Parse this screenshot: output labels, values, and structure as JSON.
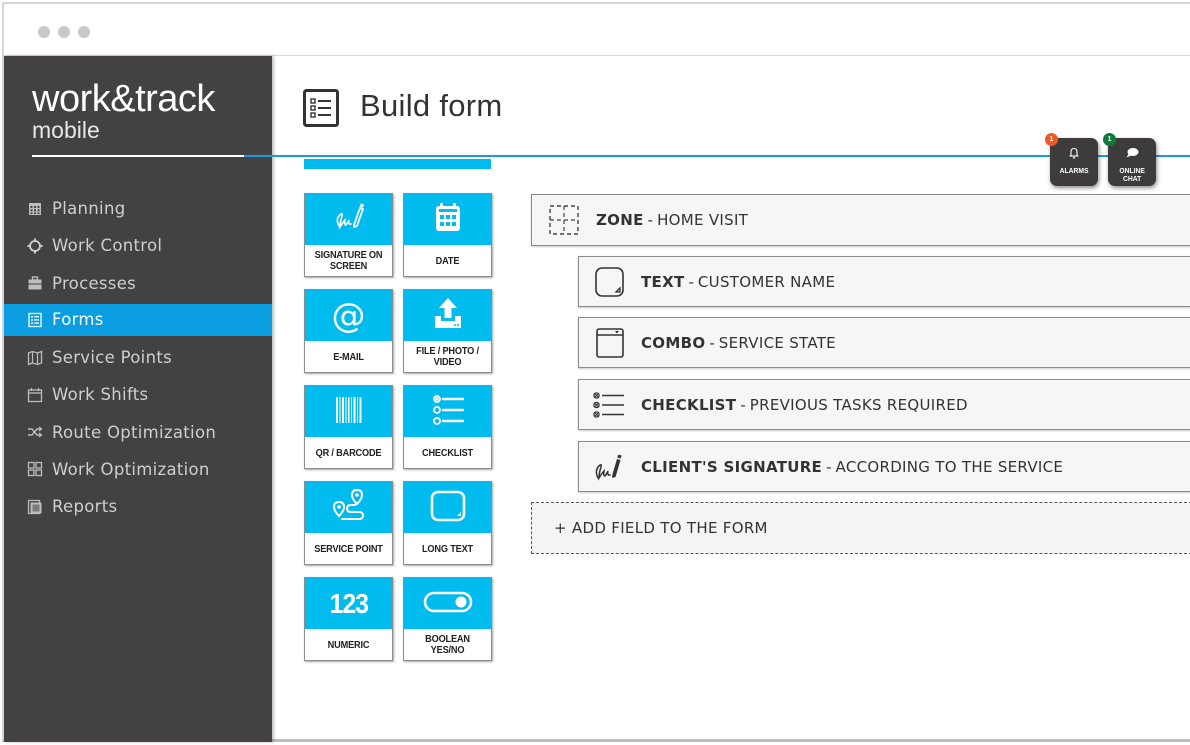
{
  "window": {
    "controls": [
      "window-dot",
      "window-dot",
      "window-dot"
    ]
  },
  "brand": {
    "name_line1": "work&track",
    "name_line2": "mobile"
  },
  "sidebar": {
    "items": [
      {
        "label": "Planning",
        "icon": "calendar-grid-icon",
        "active": false
      },
      {
        "label": "Work Control",
        "icon": "crosshair-icon",
        "active": false
      },
      {
        "label": "Processes",
        "icon": "briefcase-icon",
        "active": false
      },
      {
        "label": "Forms",
        "icon": "form-list-icon",
        "active": true
      },
      {
        "label": "Service Points",
        "icon": "map-icon",
        "active": false
      },
      {
        "label": "Work Shifts",
        "icon": "calendar-icon",
        "active": false
      },
      {
        "label": "Route Optimization",
        "icon": "shuffle-icon",
        "active": false
      },
      {
        "label": "Work Optimization",
        "icon": "grid-icon",
        "active": false
      },
      {
        "label": "Reports",
        "icon": "report-icon",
        "active": false
      }
    ]
  },
  "header": {
    "title": "Build form",
    "icon": "form-list-icon"
  },
  "floating": {
    "alarms": {
      "label": "ALARMS",
      "badge": "1",
      "badge_color": "#f05a22",
      "icon": "bell-icon"
    },
    "chat": {
      "label_line1": "ONLINE",
      "label_line2": "CHAT",
      "badge": "1",
      "badge_color": "#0d7a3a",
      "icon": "chat-bubble-icon"
    }
  },
  "palette": {
    "accent": "#00bbee",
    "tiles": [
      {
        "label": "SIGNATURE ON SCREEN",
        "icon": "signature-icon"
      },
      {
        "label": "DATE",
        "icon": "calendar-icon"
      },
      {
        "label": "E-MAIL",
        "icon": "at-sign-icon"
      },
      {
        "label": "FILE / PHOTO / VIDEO",
        "icon": "upload-icon"
      },
      {
        "label": "QR / BARCODE",
        "icon": "barcode-icon"
      },
      {
        "label": "CHECKLIST",
        "icon": "checklist-icon"
      },
      {
        "label": "SERVICE POINT",
        "icon": "route-pin-icon"
      },
      {
        "label": "LONG TEXT",
        "icon": "text-box-icon"
      },
      {
        "label": "NUMERIC",
        "icon": "numeric-icon",
        "glyph": "123"
      },
      {
        "label": "BOOLEAN YES/NO",
        "icon": "toggle-icon"
      }
    ]
  },
  "form": {
    "fields": [
      {
        "type": "ZONE",
        "name": "HOME VISIT",
        "icon": "zone-dashed-icon",
        "level": 0
      },
      {
        "type": "TEXT",
        "name": "CUSTOMER NAME",
        "icon": "text-box-icon",
        "level": 1
      },
      {
        "type": "COMBO",
        "name": "SERVICE STATE",
        "icon": "combo-icon",
        "level": 1
      },
      {
        "type": "CHECKLIST",
        "name": "PREVIOUS TASKS REQUIRED",
        "icon": "checklist-icon",
        "level": 1
      },
      {
        "type": "CLIENT'S SIGNATURE",
        "name": "ACCORDING TO THE SERVICE",
        "icon": "signature-icon",
        "level": 1
      }
    ],
    "separator": "-",
    "add_field_label": "+ ADD FIELD TO THE FORM"
  }
}
